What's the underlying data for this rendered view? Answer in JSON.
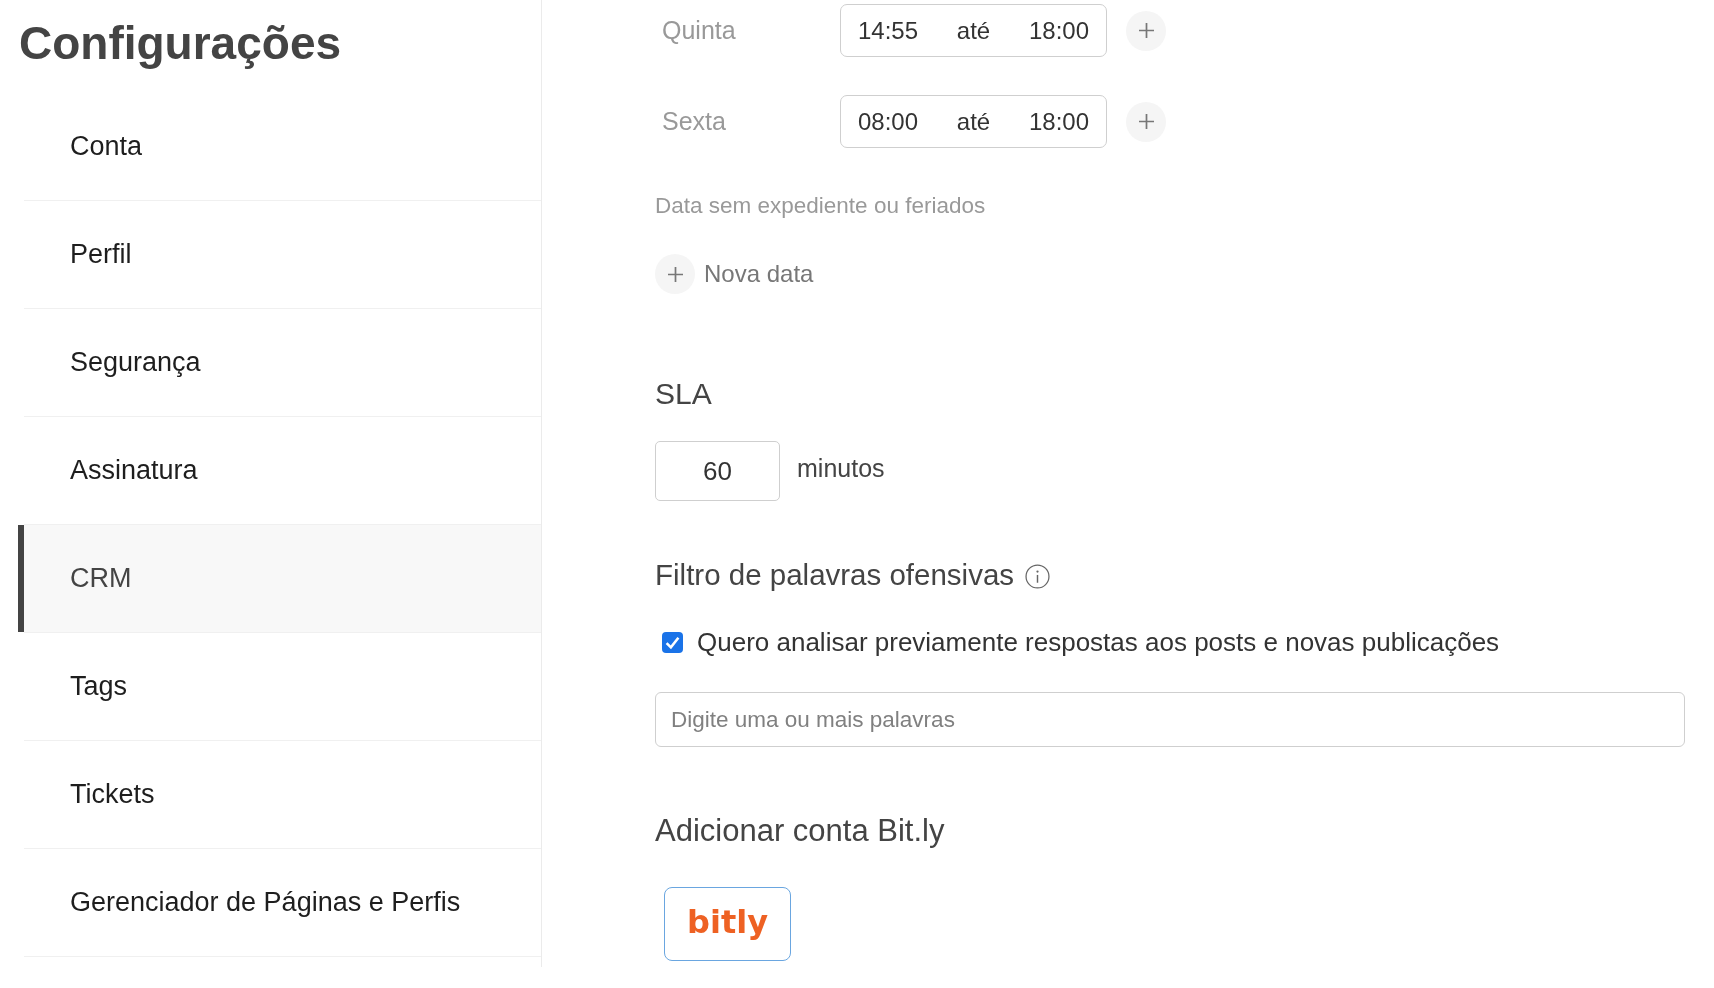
{
  "sidebar": {
    "title": "Configurações",
    "items": [
      {
        "label": "Conta",
        "selected": false
      },
      {
        "label": "Perfil",
        "selected": false
      },
      {
        "label": "Segurança",
        "selected": false
      },
      {
        "label": "Assinatura",
        "selected": false
      },
      {
        "label": "CRM",
        "selected": true
      },
      {
        "label": "Tags",
        "selected": false
      },
      {
        "label": "Tickets",
        "selected": false
      },
      {
        "label": "Gerenciador de Páginas e Perfis",
        "selected": false
      }
    ]
  },
  "business_hours": [
    {
      "day": "Quinta",
      "start": "14:55",
      "separator": "até",
      "end": "18:00"
    },
    {
      "day": "Sexta",
      "start": "08:00",
      "separator": "até",
      "end": "18:00"
    }
  ],
  "holidays": {
    "label": "Data sem expediente ou feriados",
    "add_button": "Nova data"
  },
  "sla": {
    "title": "SLA",
    "value": "60",
    "unit": "minutos"
  },
  "offensive_filter": {
    "title": "Filtro de palavras ofensivas",
    "checkbox": {
      "label": "Quero analisar previamente respostas aos posts e novas publicações",
      "checked": true
    },
    "words_field": {
      "placeholder": "Digite uma ou mais palavras"
    }
  },
  "bitly": {
    "title": "Adicionar conta Bit.ly",
    "logo_text": "bitly"
  }
}
